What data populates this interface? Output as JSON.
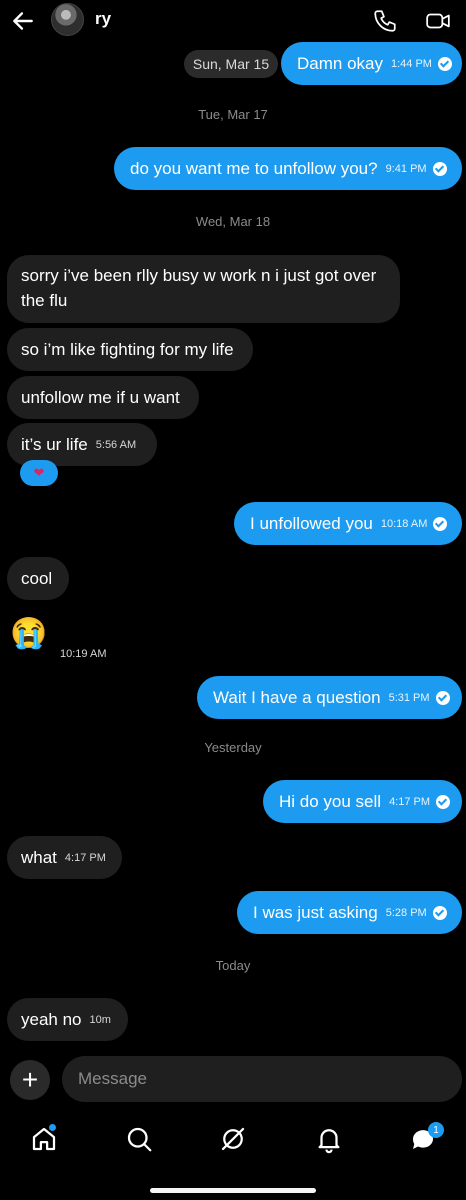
{
  "header": {
    "contact_name": "ry"
  },
  "dates": {
    "sun": "Sun, Mar 15",
    "tue": "Tue, Mar 17",
    "wed": "Wed, Mar 18",
    "yesterday": "Yesterday",
    "today": "Today"
  },
  "messages": [
    {
      "text": "Damn okay",
      "time": "1:44 PM"
    },
    {
      "text": "do you want me to unfollow you?",
      "time": "9:41 PM"
    },
    {
      "text1": "sorry i’ve been rlly busy w work n i just got over",
      "text2": "the flu"
    },
    {
      "text": "so i’m like fighting for my life"
    },
    {
      "text": "unfollow me if u want"
    },
    {
      "text": "it’s ur life",
      "time": "5:56 AM",
      "reaction": "❤"
    },
    {
      "text": "I unfollowed you",
      "time": "10:18 AM"
    },
    {
      "text": "cool"
    },
    {
      "text": "😭",
      "time": "10:19 AM"
    },
    {
      "text": "Wait I have a question",
      "time": "5:31 PM"
    },
    {
      "text": "Hi do you sell",
      "time": "4:17 PM"
    },
    {
      "text": "what",
      "time": "4:17 PM"
    },
    {
      "text": "I was just asking",
      "time": "5:28 PM"
    },
    {
      "text": "yeah no",
      "time": "10m"
    }
  ],
  "composer": {
    "placeholder": "Message",
    "plus": "+"
  },
  "nav": {
    "badge": "1"
  }
}
